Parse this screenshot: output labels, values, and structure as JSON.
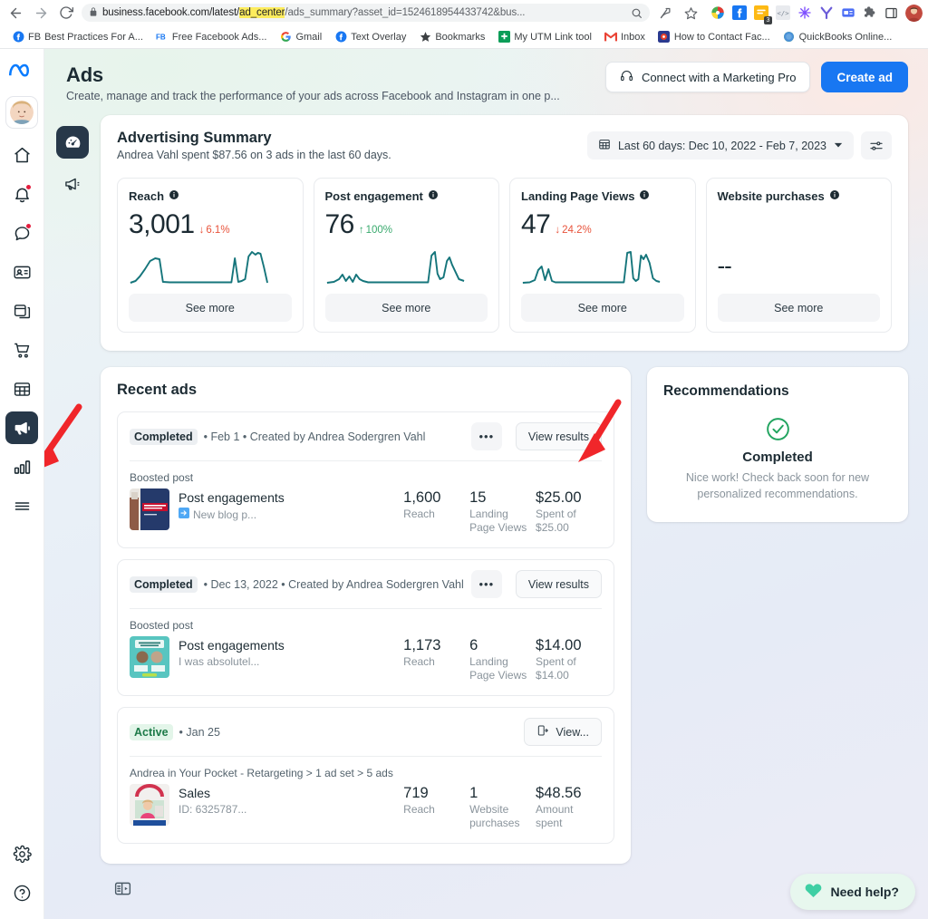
{
  "browser": {
    "url_prefix": "business.facebook.com/latest/",
    "url_highlight": "ad_center",
    "url_suffix": "/ads_summary?asset_id=1524618954433742&bus...",
    "back_icon": "back-arrow-icon",
    "forward_icon": "forward-arrow-icon",
    "reload_icon": "reload-icon",
    "lock_icon": "lock-icon",
    "search_icon": "search-icon",
    "share_icon": "share-icon",
    "star_icon": "bookmark-star-icon",
    "extension_badge": "3",
    "bookmarks": [
      {
        "label": "Best Practices For A...",
        "icon": "facebook-icon",
        "prefix": "FB"
      },
      {
        "label": "Free Facebook Ads...",
        "icon": "facebook-ads-icon",
        "prefix": "FB"
      },
      {
        "label": "Gmail",
        "icon": "google-icon",
        "prefix": ""
      },
      {
        "label": "Text Overlay",
        "icon": "facebook-icon",
        "prefix": ""
      },
      {
        "label": "Bookmarks",
        "icon": "star-icon",
        "prefix": ""
      },
      {
        "label": "My UTM Link tool",
        "icon": "utm-tool-icon",
        "prefix": ""
      },
      {
        "label": "Inbox",
        "icon": "gmail-icon",
        "prefix": ""
      },
      {
        "label": "How to Contact Fac...",
        "icon": "red-circle-icon",
        "prefix": ""
      },
      {
        "label": "QuickBooks Online...",
        "icon": "quickbooks-icon",
        "prefix": ""
      }
    ]
  },
  "rail": {
    "logo": "meta-logo",
    "avatar": "user-avatar",
    "items": [
      {
        "name": "home-icon",
        "badge": false
      },
      {
        "name": "notifications-bell-icon",
        "badge": true
      },
      {
        "name": "messages-chat-icon",
        "badge": true
      },
      {
        "name": "page-contact-card-icon",
        "badge": false
      },
      {
        "name": "posts-icon",
        "badge": false
      },
      {
        "name": "commerce-cart-icon",
        "badge": false
      },
      {
        "name": "calendar-grid-icon",
        "badge": false
      },
      {
        "name": "ads-megaphone-icon",
        "badge": false,
        "active": true
      },
      {
        "name": "insights-bars-icon",
        "badge": false
      },
      {
        "name": "menu-hamburger-icon",
        "badge": false
      }
    ],
    "bottom": [
      {
        "name": "settings-gear-icon"
      },
      {
        "name": "help-question-icon"
      }
    ]
  },
  "subrail": {
    "items": [
      {
        "name": "ads-dashboard-icon",
        "active": true
      },
      {
        "name": "ads-megaphone-icon",
        "active": false
      }
    ],
    "collapse": "panel-collapse-icon"
  },
  "header": {
    "title": "Ads",
    "subtitle": "Create, manage and track the performance of your ads across Facebook and Instagram in one p...",
    "marketing_pro_label": "Connect with a Marketing Pro",
    "marketing_pro_icon": "headset-icon",
    "create_ad_label": "Create ad"
  },
  "summary": {
    "title": "Advertising Summary",
    "subtitle": "Andrea Vahl spent $87.56 on 3 ads in the last 60 days.",
    "date_range": "Last 60 days: Dec 10, 2022 - Feb 7, 2023",
    "calendar_icon": "calendar-icon",
    "chevron_icon": "chevron-down-icon",
    "filter_icon": "filter-sliders-icon",
    "see_more_label": "See more",
    "metrics": [
      {
        "name": "Reach",
        "value": "3,001",
        "delta": "6.1%",
        "direction": "down",
        "info_icon": "info-icon"
      },
      {
        "name": "Post engagement",
        "value": "76",
        "delta": "100%",
        "direction": "up",
        "info_icon": "info-icon"
      },
      {
        "name": "Landing Page Views",
        "value": "47",
        "delta": "24.2%",
        "direction": "down",
        "info_icon": "info-icon"
      },
      {
        "name": "Website purchases",
        "value": "--",
        "delta": "",
        "direction": "none",
        "info_icon": "info-icon"
      }
    ]
  },
  "chart_data": [
    {
      "type": "line",
      "title": "Reach",
      "series": [
        {
          "name": "Reach",
          "values": [
            2,
            4,
            14,
            30,
            54,
            62,
            60,
            6,
            5,
            5,
            5,
            5,
            5,
            5,
            5,
            5,
            5,
            5,
            5,
            5,
            5,
            5,
            5,
            5,
            6,
            62,
            26,
            6,
            8,
            74,
            90,
            86,
            84,
            40,
            4
          ]
        }
      ],
      "ylim": [
        0,
        100
      ],
      "grid": false,
      "legend": "none",
      "xlabel": "",
      "ylabel": ""
    },
    {
      "type": "line",
      "title": "Post engagement",
      "series": [
        {
          "name": "Post engagement",
          "values": [
            4,
            5,
            14,
            6,
            18,
            8,
            20,
            10,
            16,
            6,
            5,
            5,
            5,
            5,
            5,
            5,
            5,
            5,
            5,
            5,
            5,
            5,
            5,
            5,
            5,
            5,
            5,
            80,
            92,
            18,
            12,
            48,
            56,
            20,
            10,
            6
          ]
        }
      ],
      "ylim": [
        0,
        100
      ],
      "grid": false,
      "legend": "none",
      "xlabel": "",
      "ylabel": ""
    },
    {
      "type": "line",
      "title": "Landing Page Views",
      "series": [
        {
          "name": "Landing Page Views",
          "values": [
            4,
            5,
            6,
            22,
            34,
            8,
            24,
            9,
            6,
            5,
            5,
            5,
            5,
            5,
            5,
            5,
            5,
            5,
            5,
            5,
            5,
            5,
            5,
            5,
            5,
            5,
            5,
            6,
            92,
            90,
            10,
            8,
            82,
            64,
            78,
            10,
            8
          ]
        }
      ],
      "ylim": [
        0,
        100
      ],
      "grid": false,
      "legend": "none",
      "xlabel": "",
      "ylabel": ""
    }
  ],
  "recent": {
    "title": "Recent ads",
    "ads": [
      {
        "status": "Completed",
        "status_type": "completed",
        "meta": "• Feb 1 • Created by Andrea Sodergren Vahl",
        "more_icon": "more-dots-icon",
        "action_label": "View results",
        "action_icon": "",
        "kicker": "Boosted post",
        "thumb": "blue-book-thumbnail",
        "objective": "Post engagements",
        "desc": "New blog p...",
        "desc_icon": "link-arrow-icon",
        "stats": [
          {
            "value": "1,600",
            "label": "Reach"
          },
          {
            "value": "15",
            "label": "Landing Page Views"
          },
          {
            "value": "$25.00",
            "label": "Spent of $25.00"
          }
        ]
      },
      {
        "status": "Completed",
        "status_type": "completed",
        "meta": "• Dec 13, 2022 • Created by Andrea Sodergren Vahl",
        "more_icon": "more-dots-icon",
        "action_label": "View results",
        "action_icon": "",
        "kicker": "Boosted post",
        "thumb": "starters-club-thumbnail",
        "objective": "Post engagements",
        "desc": "I was absolutel...",
        "desc_icon": "",
        "stats": [
          {
            "value": "1,173",
            "label": "Reach"
          },
          {
            "value": "6",
            "label": "Landing Page Views"
          },
          {
            "value": "$14.00",
            "label": "Spent of $14.00"
          }
        ]
      },
      {
        "status": "Active",
        "status_type": "active",
        "meta": "• Jan 25",
        "more_icon": "",
        "action_label": "View...",
        "action_icon": "external-link-icon",
        "kicker": "Andrea in Your Pocket - Retargeting > 1 ad set > 5 ads",
        "thumb": "andrea-pocket-thumbnail",
        "objective": "Sales",
        "desc": "ID: 6325787...",
        "desc_icon": "",
        "stats": [
          {
            "value": "719",
            "label": "Reach"
          },
          {
            "value": "1",
            "label": "Website purchases"
          },
          {
            "value": "$48.56",
            "label": "Amount spent"
          }
        ]
      }
    ]
  },
  "recommendations": {
    "title": "Recommendations",
    "check_icon": "check-circle-icon",
    "heading": "Completed",
    "body": "Nice work! Check back soon for new personalized recommendations."
  },
  "help": {
    "label": "Need help?",
    "icon": "heart-icon"
  },
  "colors": {
    "accent_blue": "#1877f2",
    "spark_teal": "#15757b",
    "down_red": "#e8533b",
    "up_green": "#3aaa6e",
    "annotation_red": "#f0262a",
    "dark_nav": "#273849"
  }
}
